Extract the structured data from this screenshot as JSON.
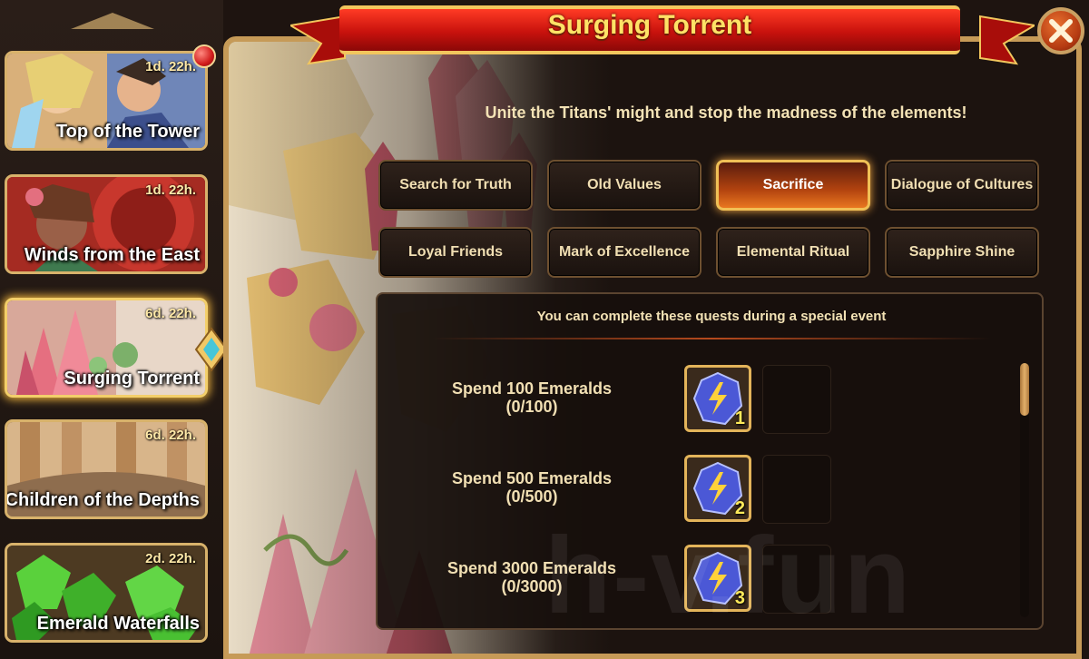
{
  "window": {
    "title": "Surging Torrent",
    "subtitle": "Unite the Titans' might and stop the madness of the elements!"
  },
  "sidebar": {
    "items": [
      {
        "title": "Top of the Tower",
        "timer": "1d. 22h.",
        "notification": true
      },
      {
        "title": "Winds from the East",
        "timer": "1d. 22h."
      },
      {
        "title": "Surging Torrent",
        "timer": "6d. 22h.",
        "active": true
      },
      {
        "title": "Children of the Depths",
        "timer": "6d. 22h."
      },
      {
        "title": "Emerald Waterfalls",
        "timer": "2d. 22h."
      }
    ]
  },
  "tabs": [
    {
      "label": "Search for Truth"
    },
    {
      "label": "Old Values"
    },
    {
      "label": "Sacrifice",
      "active": true
    },
    {
      "label": "Dialogue of Cultures"
    },
    {
      "label": "Loyal Friends"
    },
    {
      "label": "Mark of Excellence"
    },
    {
      "label": "Elemental Ritual"
    },
    {
      "label": "Sapphire Shine"
    }
  ],
  "quests": {
    "header": "You can complete these quests during a special event",
    "items": [
      {
        "name": "Spend 100 Emeralds",
        "progress": "(0/100)",
        "reward_icon": "lightning-sphere-icon",
        "reward_qty": "1"
      },
      {
        "name": "Spend 500 Emeralds",
        "progress": "(0/500)",
        "reward_icon": "lightning-sphere-icon",
        "reward_qty": "2"
      },
      {
        "name": "Spend 3000 Emeralds",
        "progress": "(0/3000)",
        "reward_icon": "lightning-sphere-icon",
        "reward_qty": "3"
      }
    ]
  },
  "watermark": "h-v.fun",
  "colors": {
    "accent_gold": "#f2c65d",
    "ribbon_red": "#c8120d",
    "active_tab": "#e97720",
    "title_yellow": "#ffe266"
  }
}
